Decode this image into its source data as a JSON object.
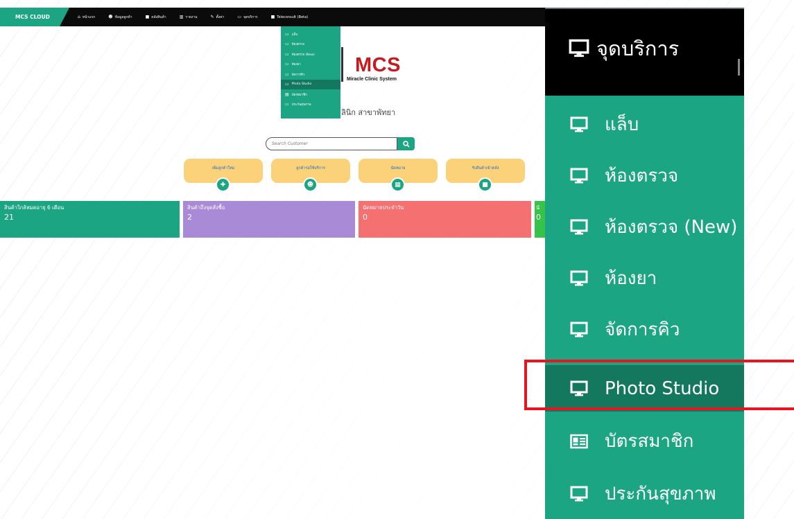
{
  "navbar": {
    "brand": "MCS CLOUD",
    "items": [
      {
        "label": "หน้าแรก",
        "icon": "home-icon"
      },
      {
        "label": "ข้อมูลลูกค้า",
        "icon": "users-icon"
      },
      {
        "label": "คลังสินค้า",
        "icon": "box-icon"
      },
      {
        "label": "รายงาน",
        "icon": "chart-icon"
      },
      {
        "label": "ตั้งค่า",
        "icon": "wrench-icon"
      },
      {
        "label": "จุดบริการ",
        "icon": "monitor-icon"
      },
      {
        "label": "Teleconsult (Beta)",
        "icon": "video-icon"
      }
    ]
  },
  "service_menu": {
    "title": "จุดบริการ",
    "items": [
      {
        "label": "แล็บ",
        "icon": "monitor-icon",
        "active": false
      },
      {
        "label": "ห้องตรวจ",
        "icon": "monitor-icon",
        "active": false
      },
      {
        "label": "ห้องตรวจ (New)",
        "icon": "monitor-icon",
        "active": false
      },
      {
        "label": "ห้องยา",
        "icon": "monitor-icon",
        "active": false
      },
      {
        "label": "จัดการคิว",
        "icon": "monitor-icon",
        "active": false
      },
      {
        "label": "Photo Studio",
        "icon": "monitor-icon",
        "active": true
      },
      {
        "label": "บัตรสมาชิก",
        "icon": "id-card-icon",
        "active": false
      },
      {
        "label": "ประกันสุขภาพ",
        "icon": "monitor-icon",
        "active": false
      }
    ]
  },
  "logo": {
    "text": "MCS",
    "subtitle": "Miracle Clinic System"
  },
  "clinic_name": "ลินิก สาขาพัทยา",
  "search": {
    "placeholder": "Search Customer"
  },
  "actions": [
    {
      "label": "เพิ่มลูกค้าใหม่",
      "icon": "add-user-icon"
    },
    {
      "label": "ลูกค้ารอใช้บริการ",
      "icon": "group-icon"
    },
    {
      "label": "นัดหมาย",
      "icon": "calendar-icon"
    },
    {
      "label": "รับสินค้าเข้าคลัง",
      "icon": "archive-icon"
    }
  ],
  "stats": [
    {
      "title": "สินค้าใกล้หมดอายุ 6 เดือน",
      "value": "21",
      "color": "#1ba583"
    },
    {
      "title": "สินค้าถึงจุดสั่งซื้อ",
      "value": "2",
      "color": "#a98ad6"
    },
    {
      "title": "นัดหมายประจำวัน",
      "value": "0",
      "color": "#f57070"
    },
    {
      "title": "นั",
      "value": "0",
      "color": "#37c24a"
    }
  ],
  "colors": {
    "brand_green": "#1ba583",
    "active_green": "#14785f",
    "navbar": "#0b0b0b",
    "logo_red": "#c8191f",
    "button_yellow": "#fbd17a",
    "highlight_red": "#e8141f"
  }
}
